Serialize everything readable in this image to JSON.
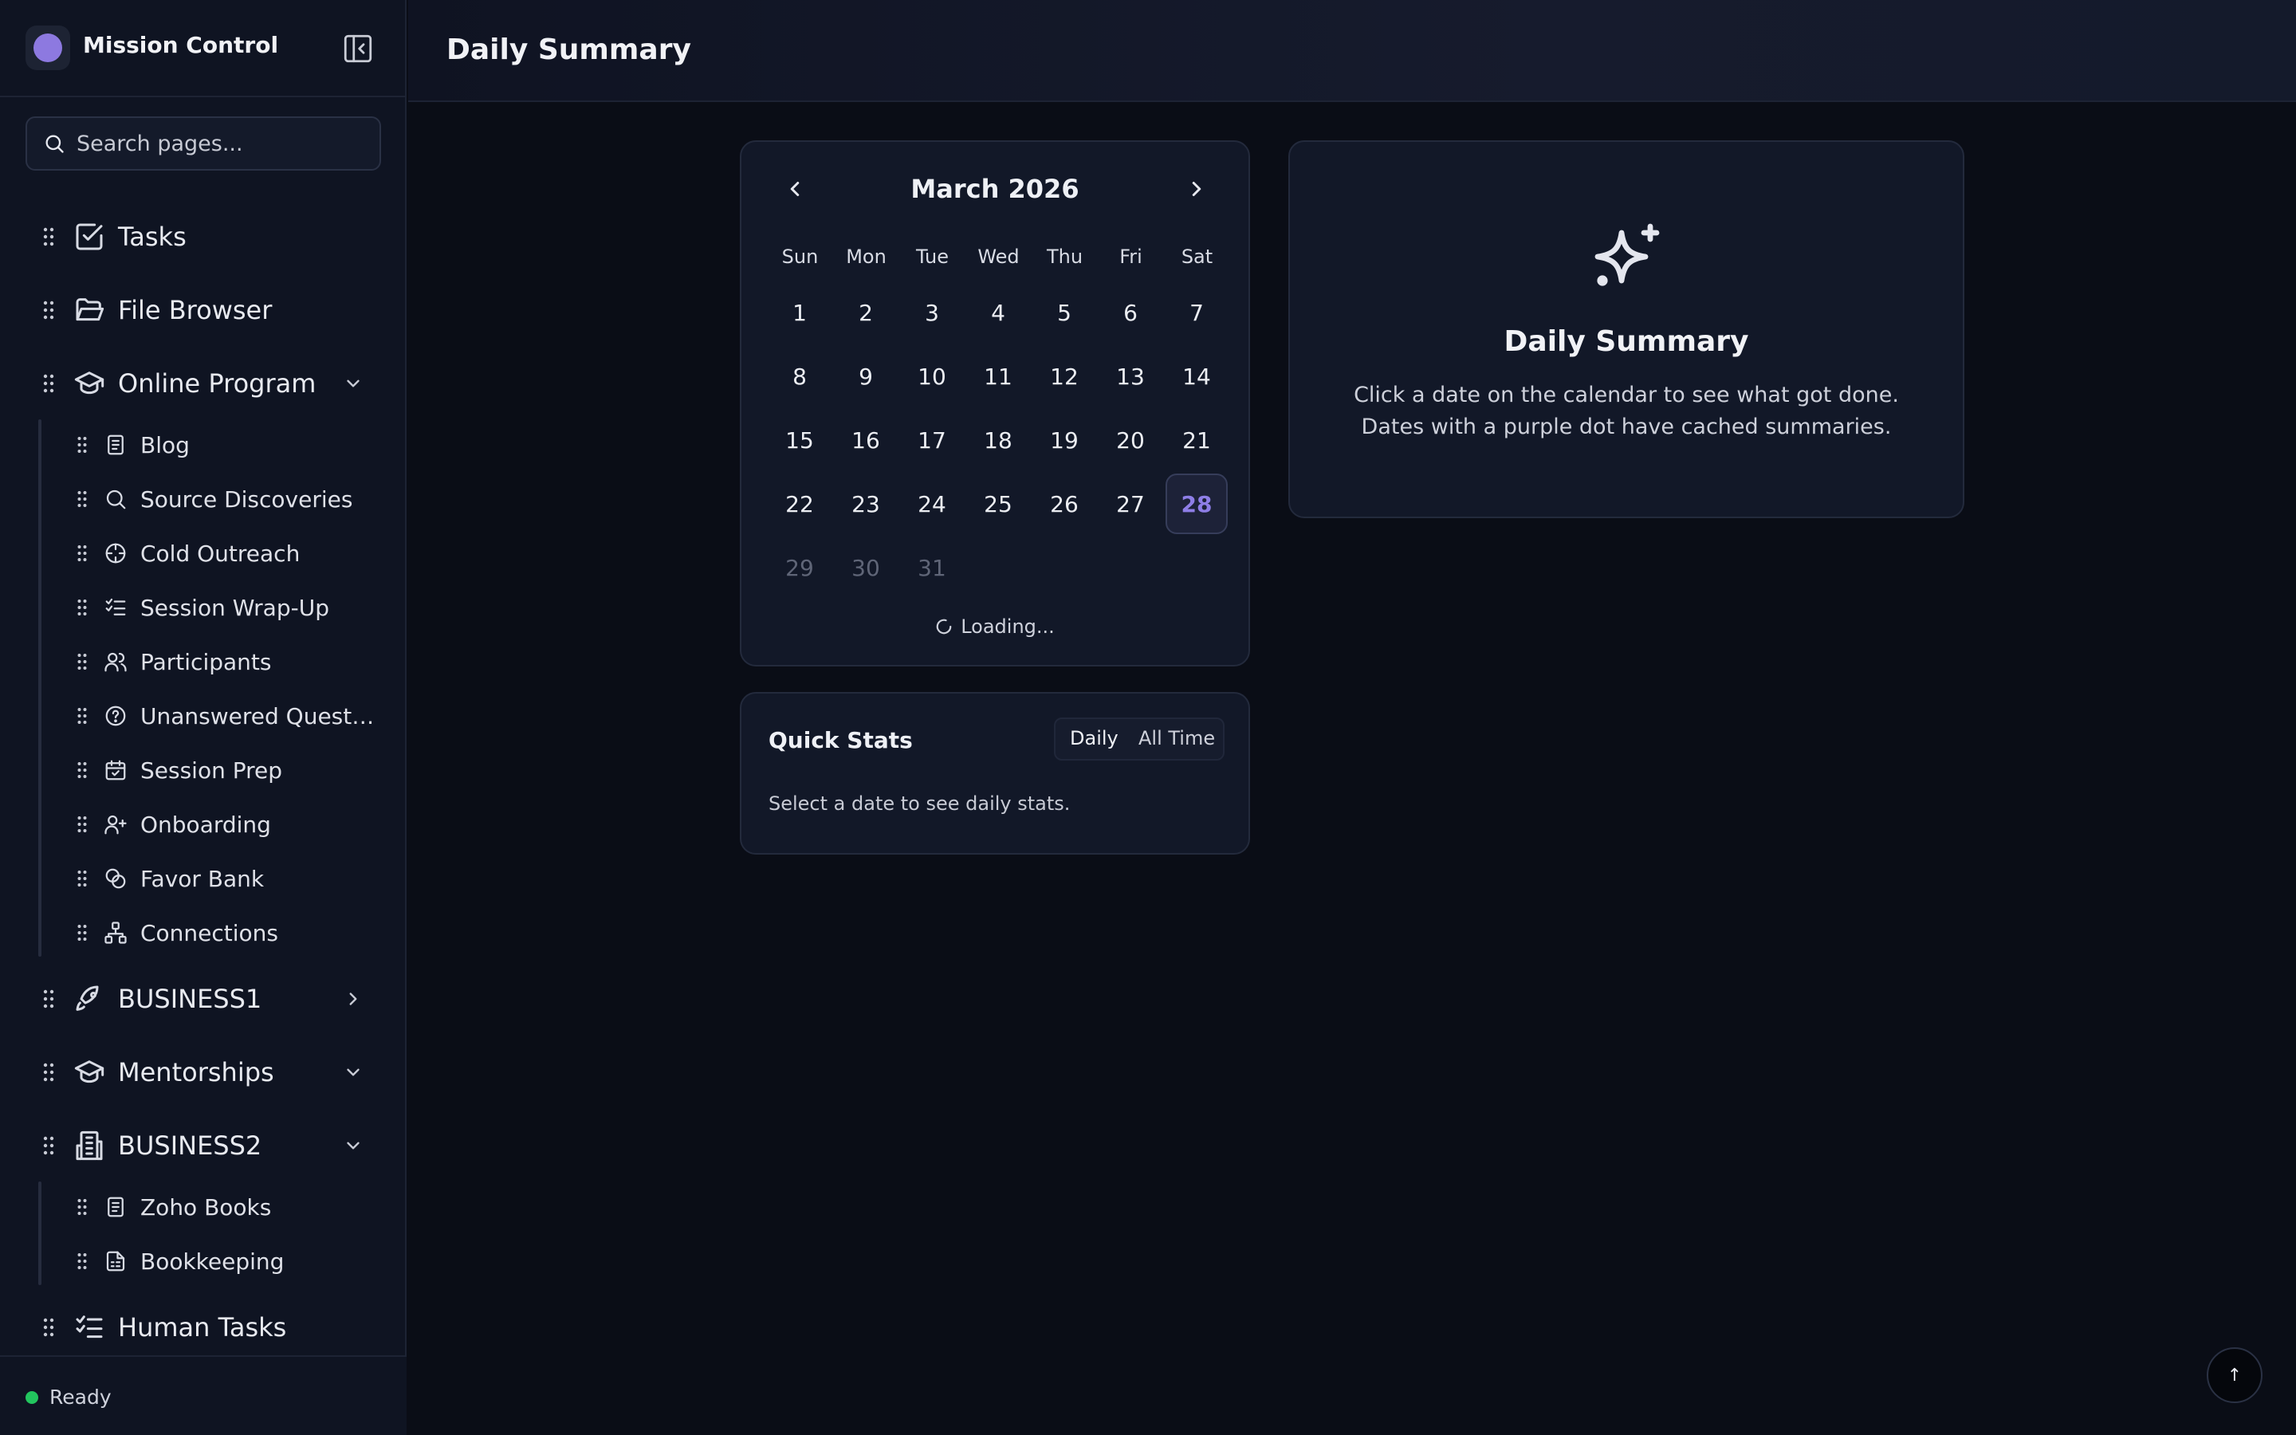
{
  "app": {
    "title": "Mission Control"
  },
  "search": {
    "placeholder": "Search pages..."
  },
  "sidebar": {
    "items": [
      {
        "label": "Tasks",
        "icon": "checkbox-icon"
      },
      {
        "label": "File Browser",
        "icon": "folder-open-icon"
      },
      {
        "label": "Online Program",
        "icon": "graduation-cap-icon",
        "expanded": true,
        "children": [
          {
            "label": "Blog",
            "icon": "document-icon"
          },
          {
            "label": "Source Discoveries",
            "icon": "search-icon"
          },
          {
            "label": "Cold Outreach",
            "icon": "crosshair-icon"
          },
          {
            "label": "Session Wrap-Up",
            "icon": "list-checks-icon"
          },
          {
            "label": "Participants",
            "icon": "users-icon"
          },
          {
            "label": "Unanswered Questio...",
            "icon": "help-circle-icon"
          },
          {
            "label": "Session Prep",
            "icon": "calendar-check-icon"
          },
          {
            "label": "Onboarding",
            "icon": "user-plus-icon"
          },
          {
            "label": "Favor Bank",
            "icon": "coins-icon"
          },
          {
            "label": "Connections",
            "icon": "network-icon"
          }
        ]
      },
      {
        "label": "BUSINESS1",
        "icon": "rocket-icon",
        "expanded": false
      },
      {
        "label": "Mentorships",
        "icon": "graduation-cap-icon",
        "expanded": false
      },
      {
        "label": "BUSINESS2",
        "icon": "building-icon",
        "expanded": true,
        "children": [
          {
            "label": "Zoho Books",
            "icon": "document-icon"
          },
          {
            "label": "Bookkeeping",
            "icon": "file-spreadsheet-icon"
          }
        ]
      },
      {
        "label": "Human Tasks",
        "icon": "list-checks-icon"
      }
    ]
  },
  "status": {
    "text": "Ready",
    "color": "#22c55e"
  },
  "page": {
    "title": "Daily Summary"
  },
  "calendar": {
    "month_label": "March 2026",
    "weekdays": [
      "Sun",
      "Mon",
      "Tue",
      "Wed",
      "Thu",
      "Fri",
      "Sat"
    ],
    "weeks": [
      [
        "1",
        "2",
        "3",
        "4",
        "5",
        "6",
        "7"
      ],
      [
        "8",
        "9",
        "10",
        "11",
        "12",
        "13",
        "14"
      ],
      [
        "15",
        "16",
        "17",
        "18",
        "19",
        "20",
        "21"
      ],
      [
        "22",
        "23",
        "24",
        "25",
        "26",
        "27",
        "28"
      ],
      [
        "29",
        "30",
        "31"
      ]
    ],
    "selected_day": "28",
    "muted_days": [
      "29",
      "30",
      "31"
    ],
    "loading_text": "Loading...",
    "accent": "#8e7ee6"
  },
  "summary": {
    "title": "Daily Summary",
    "line1": "Click a date on the calendar to see what got done.",
    "line2": "Dates with a purple dot have cached summaries."
  },
  "stats": {
    "title": "Quick Stats",
    "tab_daily": "Daily",
    "tab_all": "All Time",
    "hint": "Select a date to see daily stats."
  },
  "scroll_top": {
    "label": "↑"
  }
}
